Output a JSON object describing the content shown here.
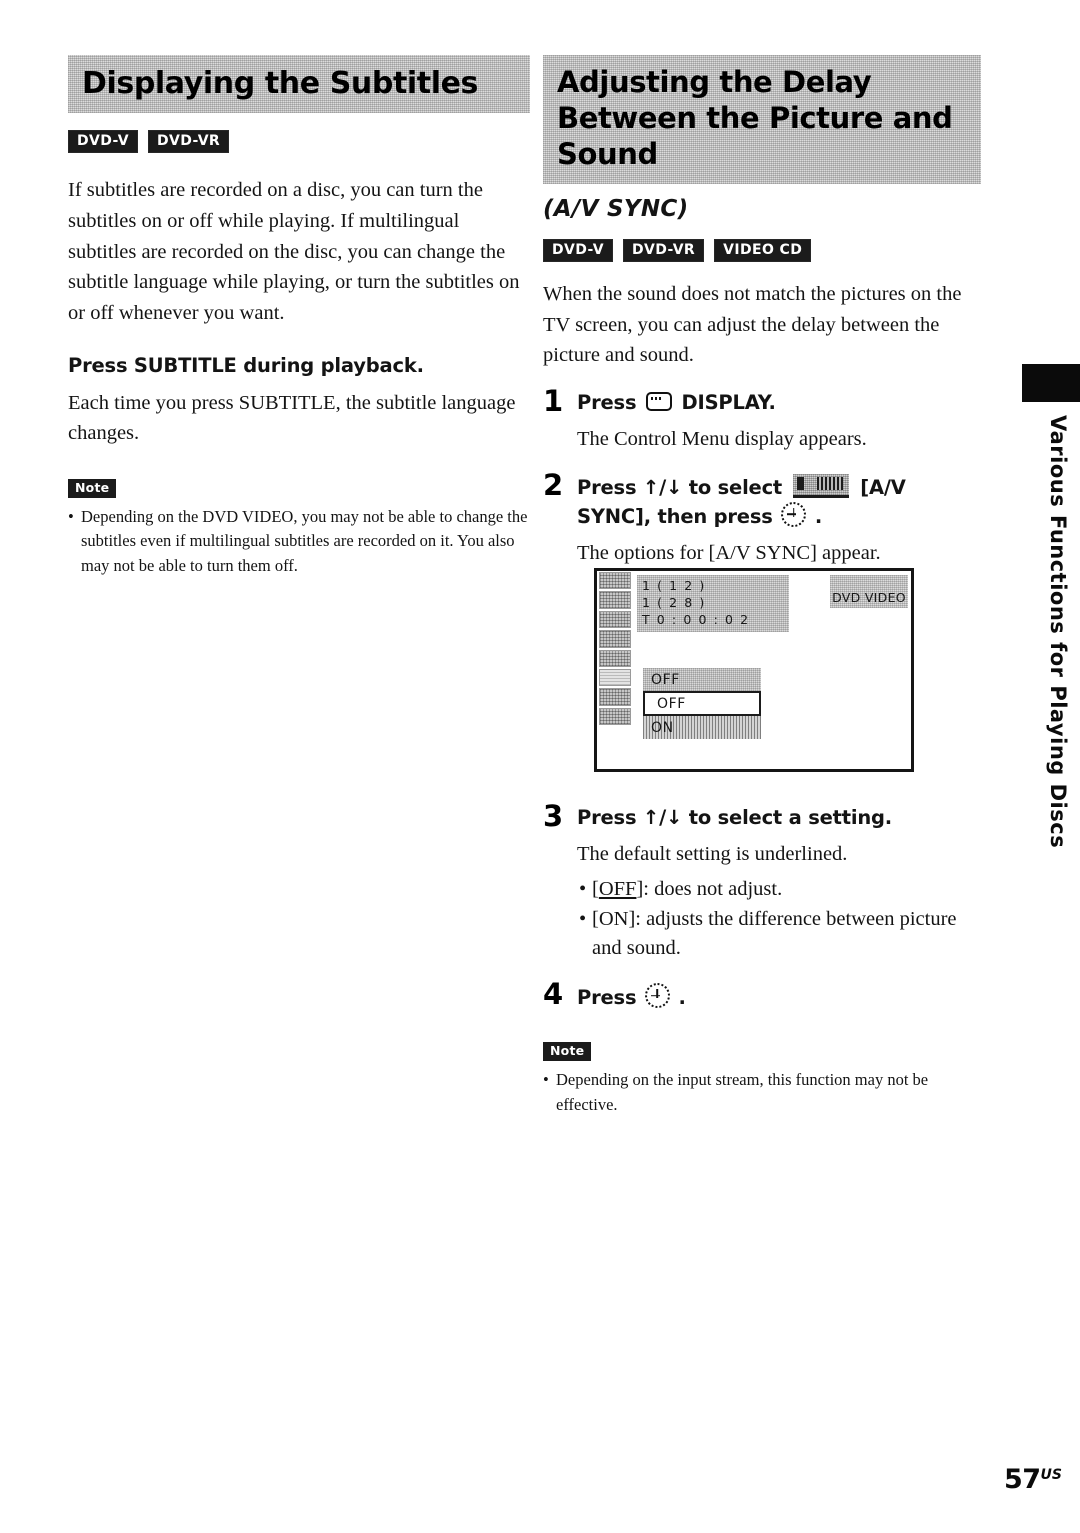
{
  "page": {
    "folio_number": "57",
    "folio_suffix": "US"
  },
  "side_tab": {
    "label": "Various Functions for Playing Discs"
  },
  "left_column": {
    "heading": "Displaying the Subtitles",
    "badges": [
      "DVD-V",
      "DVD-VR"
    ],
    "intro": "If subtitles are recorded on a disc, you can turn the subtitles on or off while playing. If multilingual subtitles are recorded on the disc, you can change the subtitle language while playing, or turn the subtitles on or off whenever you want.",
    "instruction": "Press SUBTITLE during playback.",
    "instruction_detail": "Each time you press SUBTITLE, the subtitle language changes.",
    "note": {
      "tag": "Note",
      "items": [
        "Depending on the DVD VIDEO, you may not be able to change the subtitles even if multilingual subtitles are recorded on it. You also may not be able to turn them off."
      ]
    }
  },
  "right_column": {
    "heading": "Adjusting the Delay Between the Picture and Sound",
    "subtitle": "(A/V SYNC)",
    "badges": [
      "DVD-V",
      "DVD-VR",
      "VIDEO CD"
    ],
    "intro": "When the sound does not match the pictures on the TV screen, you can adjust the delay between the picture and sound.",
    "steps": [
      {
        "number": "1",
        "head_before": "Press",
        "head_after": "DISPLAY.",
        "desc": "The Control Menu display appears."
      },
      {
        "number": "2",
        "head_before": "Press ↑/↓ to select",
        "head_middle": "[A/V SYNC],",
        "head_after": "then press",
        "head_end": ".",
        "desc": "The options for [A/V SYNC] appear."
      },
      {
        "number": "3",
        "head": "Press ↑/↓ to select a setting.",
        "desc": "The default setting is underlined.",
        "bullets": [
          {
            "label": "OFF",
            "underlined": true,
            "text": ": does not adjust."
          },
          {
            "label": "ON",
            "underlined": false,
            "text": ": adjusts the difference between picture and sound."
          }
        ]
      },
      {
        "number": "4",
        "head_before": "Press",
        "head_after": "."
      }
    ],
    "note": {
      "tag": "Note",
      "items": [
        "Depending on the input stream, this function may not be effective."
      ]
    }
  },
  "tv_figure": {
    "status_lines": [
      "1 ( 1 2 )",
      "1 ( 2 8 )",
      "T   0 : 0 0 : 0 2"
    ],
    "disc_label": "DVD VIDEO",
    "options": [
      {
        "label": "OFF",
        "state": "header"
      },
      {
        "label": "OFF",
        "state": "current"
      },
      {
        "label": "ON",
        "state": "striped"
      }
    ],
    "icon_cells": 8
  }
}
